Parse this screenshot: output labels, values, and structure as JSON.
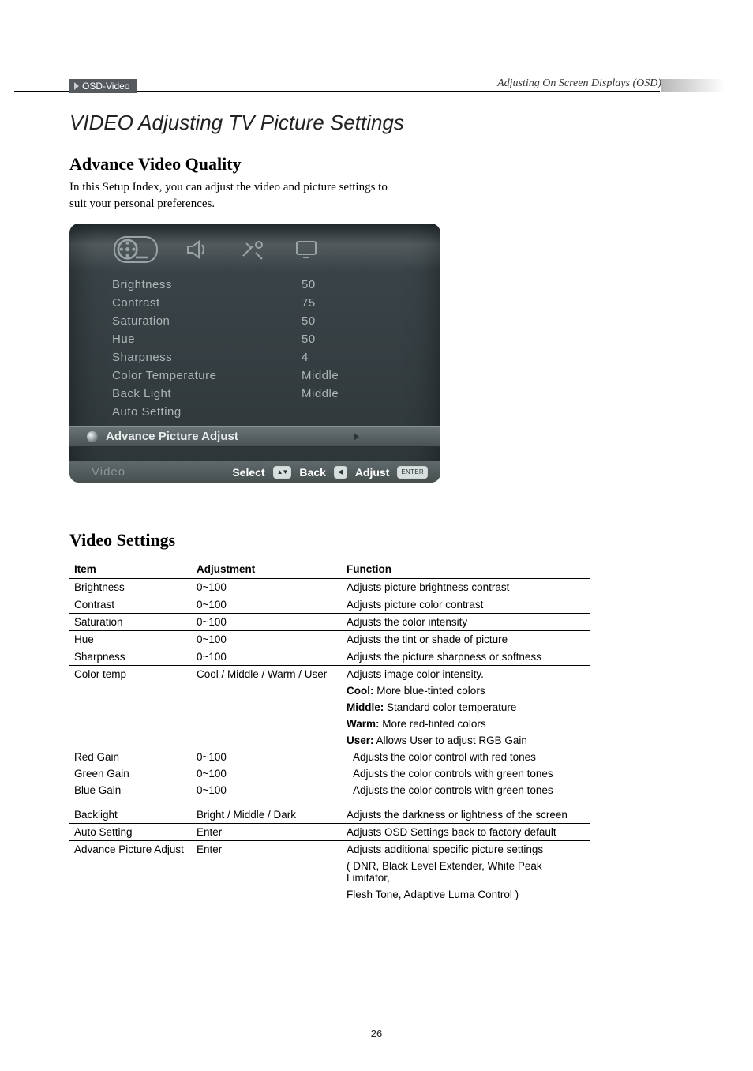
{
  "header": {
    "tab": "OSD-Video",
    "breadcrumb": "Adjusting On Screen Displays (OSD)"
  },
  "main_title": "VIDEO Adjusting TV Picture Settings",
  "section1": {
    "title": "Advance Video Quality",
    "intro_line1": "In this Setup Index, you can adjust the video and picture settings to",
    "intro_line2": "suit your personal preferences."
  },
  "osd": {
    "rows": [
      {
        "label": "Brightness",
        "value": "50"
      },
      {
        "label": "Contrast",
        "value": "75"
      },
      {
        "label": "Saturation",
        "value": "50"
      },
      {
        "label": "Hue",
        "value": "50"
      },
      {
        "label": "Sharpness",
        "value": "4"
      },
      {
        "label": "Color Temperature",
        "value": "Middle"
      },
      {
        "label": "Back Light",
        "value": "Middle"
      },
      {
        "label": "Auto Setting",
        "value": ""
      }
    ],
    "selected": "Advance Picture Adjust",
    "footer_title": "Video",
    "footer_select": "Select",
    "footer_back": "Back",
    "footer_adjust": "Adjust"
  },
  "section2": {
    "title": "Video Settings",
    "headers": {
      "item": "Item",
      "adj": "Adjustment",
      "func": "Function"
    },
    "rows": [
      {
        "item": "Brightness",
        "adj": "0~100",
        "func": "Adjusts picture brightness contrast",
        "rule": true
      },
      {
        "item": "Contrast",
        "adj": "0~100",
        "func": "Adjusts picture color contrast",
        "rule": true
      },
      {
        "item": "Saturation",
        "adj": "0~100",
        "func": "Adjusts the color intensity",
        "rule": true
      },
      {
        "item": "Hue",
        "adj": "0~100",
        "func": "Adjusts the tint or shade of picture",
        "rule": true
      },
      {
        "item": "Sharpness",
        "adj": "0~100",
        "func": "Adjusts the picture sharpness or softness",
        "rule": true
      },
      {
        "item": "Color temp",
        "adj": "Cool / Middle / Warm / User",
        "func": "Adjusts image color intensity."
      },
      {
        "item": "",
        "adj": "",
        "func_bold": "Cool:",
        "func_rest": " More blue-tinted colors"
      },
      {
        "item": "",
        "adj": "",
        "func_bold": "Middle:",
        "func_rest": " Standard color temperature"
      },
      {
        "item": "",
        "adj": "",
        "func_bold": "Warm:",
        "func_rest": " More red-tinted colors"
      },
      {
        "item": "",
        "adj": "",
        "func_bold": "User:",
        "func_rest": " Allows User to adjust RGB Gain"
      },
      {
        "item": "Red Gain",
        "indent": true,
        "adj": "0~100",
        "func": "Adjusts the color control with red tones",
        "func_indent": true
      },
      {
        "item": "Green Gain",
        "indent": true,
        "adj": "0~100",
        "func": "Adjusts the color controls with green tones",
        "func_indent": true
      },
      {
        "item": "Blue Gain",
        "indent": true,
        "adj": "0~100",
        "func": "Adjusts the color controls with green tones",
        "func_indent": true
      },
      {
        "spacer": true
      },
      {
        "item": "Backlight",
        "adj": "Bright / Middle / Dark",
        "func": "Adjusts the darkness or lightness of the screen",
        "rule": true
      },
      {
        "item": "Auto Setting",
        "adj": "Enter",
        "func": "Adjusts OSD Settings back to factory default",
        "rule": true
      },
      {
        "item": "Advance Picture Adjust",
        "adj": "Enter",
        "func": "Adjusts additional specific picture settings"
      },
      {
        "item": "",
        "adj": "",
        "func": "( DNR, Black Level Extender, White Peak Limitator,"
      },
      {
        "item": "",
        "adj": "",
        "func": "Flesh Tone, Adaptive Luma Control )"
      }
    ]
  },
  "page_number": "26"
}
